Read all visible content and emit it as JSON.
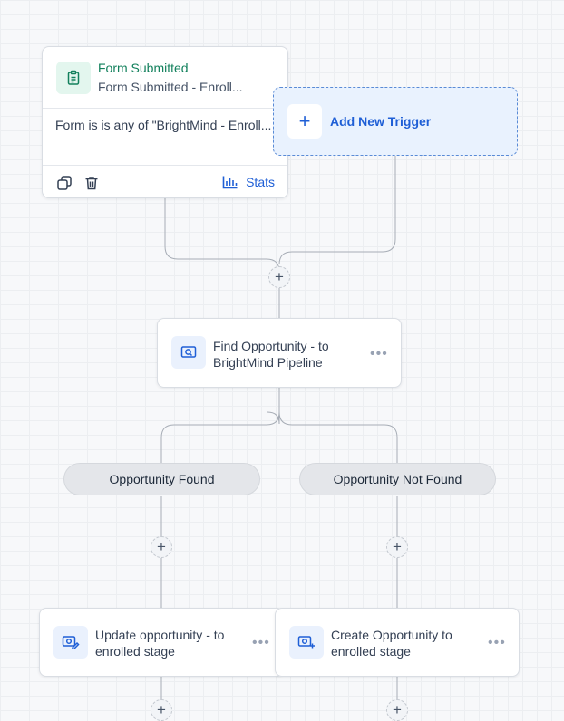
{
  "trigger": {
    "title": "Form Submitted",
    "subtitle": "Form Submitted - Enroll...",
    "condition": "Form is is any of \"BrightMind - Enroll...",
    "stats_label": "Stats",
    "icon": "clipboard-icon"
  },
  "add_trigger": {
    "label": "Add New Trigger",
    "icon": "plus-icon"
  },
  "find_action": {
    "line1": "Find Opportunity - to",
    "line2": "BrightMind Pipeline",
    "icon": "search-opportunity-icon",
    "more": "•••"
  },
  "branches": [
    {
      "label": "Opportunity Found"
    },
    {
      "label": "Opportunity Not Found"
    }
  ],
  "update_action": {
    "line1": "Update opportunity - to",
    "line2": "enrolled stage",
    "icon": "edit-opportunity-icon",
    "more": "•••"
  },
  "create_action": {
    "line1": "Create Opportunity to",
    "line2": "enrolled stage",
    "icon": "add-opportunity-icon",
    "more": "•••"
  },
  "plus_symbol": "+",
  "colors": {
    "accent": "#1f5fd6",
    "trigger_title": "#12805c",
    "trigger_icon_bg": "#e3f6ee",
    "action_icon_bg": "#eaf1fd"
  }
}
